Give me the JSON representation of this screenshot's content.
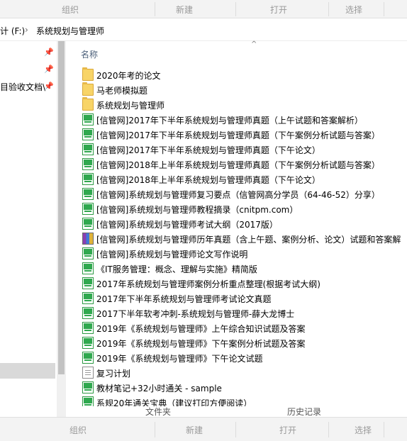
{
  "ribbon_top": {
    "organize": "组织",
    "new": "新建",
    "open": "打开",
    "select": "选择"
  },
  "address": {
    "drive": "计 (F:)",
    "chevron": "›",
    "folder": "系统规划与管理师"
  },
  "nav": {
    "partial_item": "目验收文档\\"
  },
  "header": {
    "name_col": "名称",
    "sort_glyph": "^"
  },
  "files": [
    {
      "type": "folder",
      "name": "2020年考的论文"
    },
    {
      "type": "folder",
      "name": "马老师模拟题"
    },
    {
      "type": "folder",
      "name": "系统规划与管理师"
    },
    {
      "type": "pdf",
      "name": "[信管网]2017年下半年系统规划与管理师真题（上午试题和答案解析）"
    },
    {
      "type": "pdf",
      "name": "[信管网]2017年下半年系统规划与管理师真题（下午案例分析试题与答案）"
    },
    {
      "type": "pdf",
      "name": "[信管网]2017年下半年系统规划与管理师真题（下午论文）"
    },
    {
      "type": "pdf",
      "name": "[信管网]2018年上半年系统规划与管理师真题（下午案例分析试题与答案）"
    },
    {
      "type": "pdf",
      "name": "[信管网]2018年上半年系统规划与管理师真题（下午论文）"
    },
    {
      "type": "pdf",
      "name": "[信管网]系统规划与管理师复习要点（信管网高分学员（64-46-52）分享）"
    },
    {
      "type": "pdf",
      "name": "[信管网]系统规划与管理师教程摘录（cnitpm.com）"
    },
    {
      "type": "pdf",
      "name": "[信管网]系统规划与管理师考试大纲（2017版）"
    },
    {
      "type": "rar",
      "name": "[信管网]系统规划与管理师历年真题（含上午题、案例分析、论文）试题和答案解"
    },
    {
      "type": "pdf",
      "name": "[信管网]系统规划与管理师论文写作说明"
    },
    {
      "type": "pdf",
      "name": "《IT服务管理：概念、理解与实施》精简版"
    },
    {
      "type": "pdf",
      "name": "2017年系统规划与管理师案例分析重点整理(根据考试大纲)"
    },
    {
      "type": "pdf",
      "name": "2017年下半年系统规划与管理师考试论文真题"
    },
    {
      "type": "pdf",
      "name": "2017下半年软考冲刺-系统规划与管理师-薛大龙博士"
    },
    {
      "type": "pdf",
      "name": "2019年《系统规划与管理师》上午综合知识试题及答案"
    },
    {
      "type": "pdf",
      "name": "2019年《系统规划与管理师》下午案例分析试题及答案"
    },
    {
      "type": "pdf",
      "name": "2019年《系统规划与管理师》下午论文试题"
    },
    {
      "type": "txt",
      "name": "复习计划"
    },
    {
      "type": "pdf",
      "name": "教材笔记+32小时通关 - sample"
    },
    {
      "type": "pdf",
      "name": "系规20年通关宝典（建议打印方便阅读）"
    }
  ],
  "ghost_labels": {
    "left": "文件夹",
    "right": "历史记录"
  },
  "ribbon_bottom": {
    "organize": "组织",
    "new": "新建",
    "open": "打开",
    "select": "选择"
  }
}
